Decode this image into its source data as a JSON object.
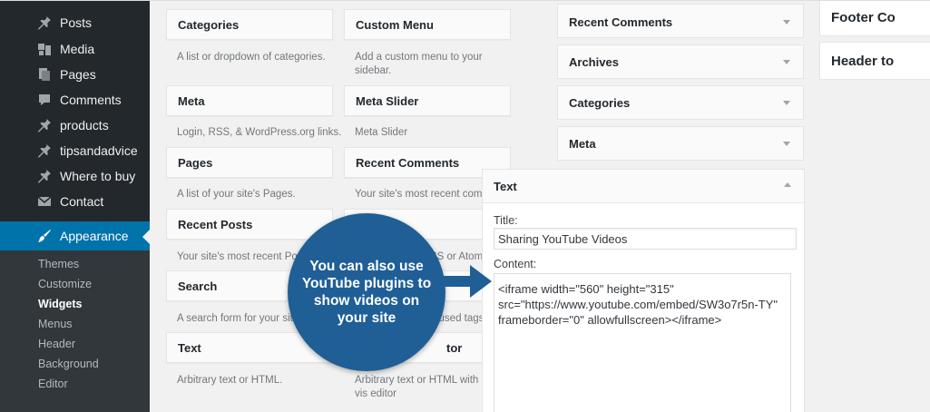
{
  "sidebar": {
    "items": [
      {
        "label": "Posts",
        "icon": "pin-icon"
      },
      {
        "label": "Media",
        "icon": "media-icon"
      },
      {
        "label": "Pages",
        "icon": "pages-icon"
      },
      {
        "label": "Comments",
        "icon": "comment-icon"
      },
      {
        "label": "products",
        "icon": "pin-icon"
      },
      {
        "label": "tipsandadvice",
        "icon": "pin-icon"
      },
      {
        "label": "Where to buy",
        "icon": "pin-icon"
      },
      {
        "label": "Contact",
        "icon": "mail-icon"
      }
    ],
    "active": {
      "label": "Appearance",
      "icon": "brush-icon"
    },
    "submenu": [
      "Themes",
      "Customize",
      "Widgets",
      "Menus",
      "Header",
      "Background",
      "Editor"
    ],
    "current_submenu": "Widgets"
  },
  "available_widgets": {
    "left": [
      {
        "title": "Categories",
        "desc": "A list or dropdown of categories."
      },
      {
        "title": "Meta",
        "desc": "Login, RSS, & WordPress.org links."
      },
      {
        "title": "Pages",
        "desc": "A list of your site's Pages."
      },
      {
        "title": "Recent Posts",
        "desc": "Your site's most recent Posts."
      },
      {
        "title": "Search",
        "desc": "A search form for your site."
      },
      {
        "title": "Text",
        "desc": "Arbitrary text or HTML."
      }
    ],
    "right": [
      {
        "title": "Custom Menu",
        "desc": "Add a custom menu to your sidebar."
      },
      {
        "title": "Meta Slider",
        "desc": "Meta Slider"
      },
      {
        "title": "Recent Comments",
        "desc": "Your site's most recent comme"
      },
      {
        "desc_partial": "SS or Atom f"
      },
      {
        "desc_partial": "ost used tags"
      },
      {
        "title_partial": "tor",
        "desc": "Arbitrary text or HTML with vis editor"
      }
    ]
  },
  "widget_area": {
    "widgets": [
      "Recent Comments",
      "Archives",
      "Categories",
      "Meta"
    ],
    "expanded": {
      "title": "Text",
      "title_label": "Title:",
      "title_value": "Sharing YouTube Videos",
      "content_label": "Content:",
      "content_value": "<iframe width=\"560\" height=\"315\"\nsrc=\"https://www.youtube.com/embed/SW3o7r5n-TY\"\nframeborder=\"0\" allowfullscreen></iframe>"
    }
  },
  "far_right": {
    "boxes": [
      "Footer Co",
      "Header to"
    ]
  },
  "callout": {
    "text": "You can also use YouTube plugins to show videos on your site",
    "color": "#1f5f96"
  },
  "colors": {
    "sidebar_bg": "#23282d",
    "active_bg": "#0073aa"
  }
}
